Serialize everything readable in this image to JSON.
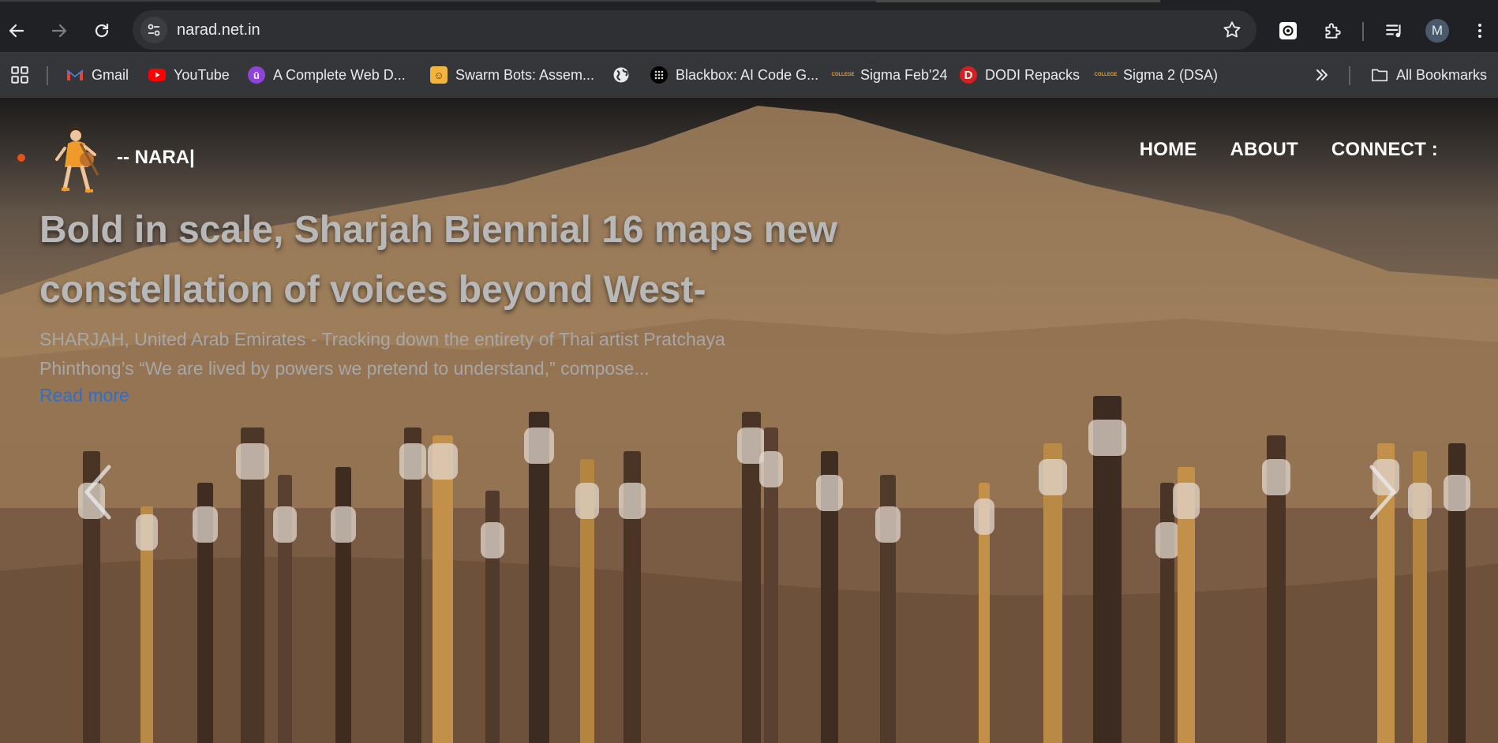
{
  "browser": {
    "url": "narad.net.in",
    "profile_initial": "M"
  },
  "bookmarks": {
    "items": [
      {
        "label": "Gmail",
        "icon": "gmail-icon"
      },
      {
        "label": "YouTube",
        "icon": "youtube-icon"
      },
      {
        "label": "A Complete Web D...",
        "icon": "udemy-icon"
      },
      {
        "label": "Swarm Bots: Assem...",
        "icon": "game-icon"
      },
      {
        "label": "",
        "icon": "globe-icon"
      },
      {
        "label": "Blackbox: AI Code G...",
        "icon": "blackbox-icon"
      },
      {
        "label": "Sigma Feb'24",
        "icon": "college-icon"
      },
      {
        "label": "DODI Repacks",
        "icon": "dodi-icon"
      },
      {
        "label": "Sigma 2 (DSA)",
        "icon": "college-icon"
      }
    ],
    "all_bookmarks_label": "All Bookmarks"
  },
  "site": {
    "brand": "-- NARA|",
    "nav": [
      "HOME",
      "ABOUT",
      "CONNECT :"
    ],
    "article": {
      "headline": "Bold in scale, Sharjah Biennial 16 maps new constellation of voices beyond West-",
      "excerpt": "SHARJAH, United Arab Emirates - Tracking down the entirety of Thai artist Pratchaya Phinthong’s “We are lived by powers we pretend to understand,” compose...",
      "read_more": "Read more"
    }
  },
  "colors": {
    "chrome_bg": "#202124",
    "bookmarks_bg": "#35363a",
    "link_blue": "#2a6fd1",
    "accent_dot": "#e8501a"
  }
}
